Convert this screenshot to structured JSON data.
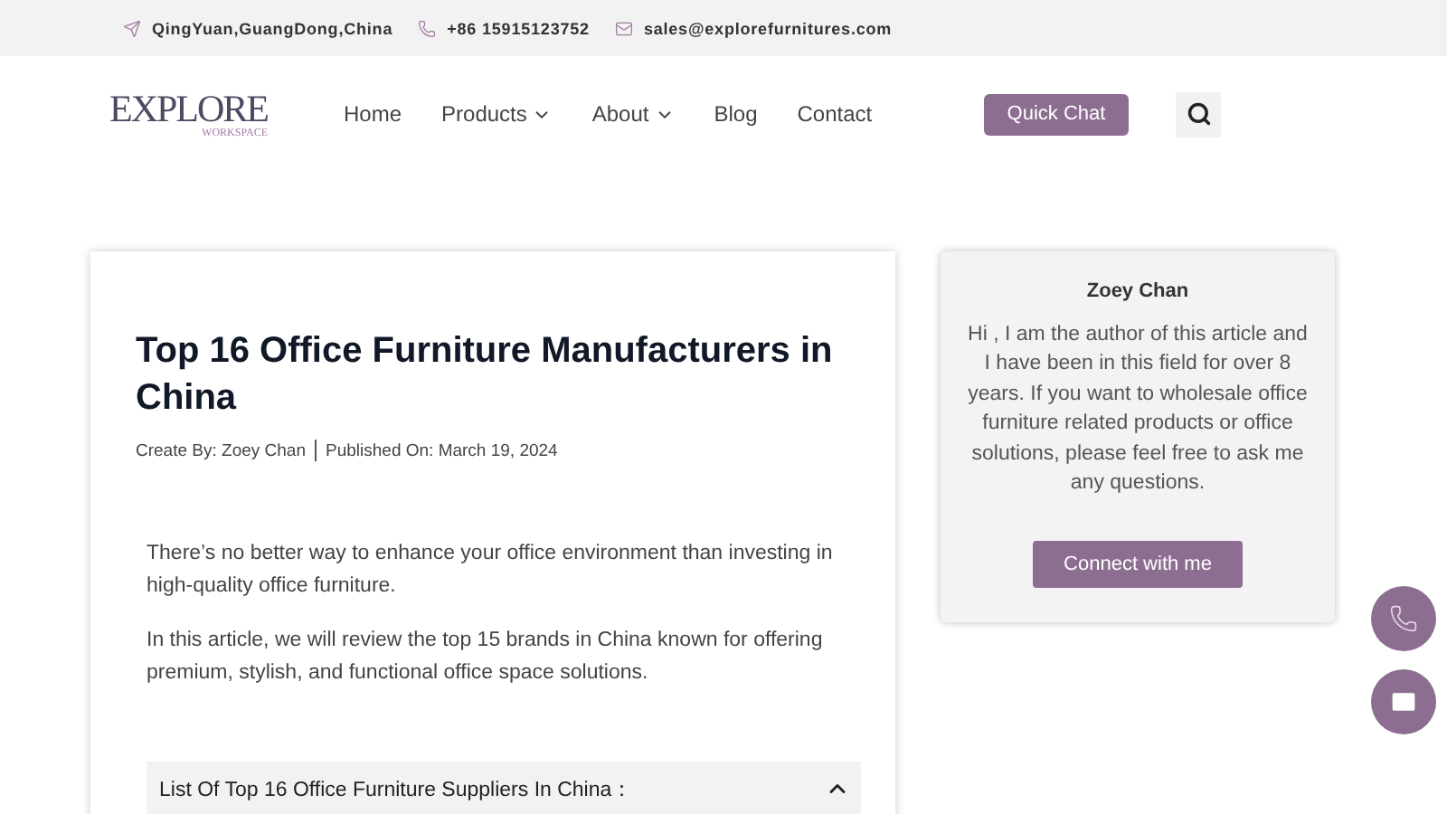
{
  "topbar": [
    {
      "kind": "location",
      "text": "QingYuan,GuangDong,China"
    },
    {
      "kind": "phone",
      "text": "+86 15915123752"
    },
    {
      "kind": "email",
      "text": "sales@explorefurnitures.com"
    }
  ],
  "header": {
    "logo": {
      "main": "EXPLORE",
      "sub": "WORKSPACE"
    },
    "nav": [
      {
        "label": "Home",
        "dropdown": false
      },
      {
        "label": "Products",
        "dropdown": true
      },
      {
        "label": "About",
        "dropdown": true
      },
      {
        "label": "Blog",
        "dropdown": false
      },
      {
        "label": "Contact",
        "dropdown": false
      }
    ],
    "cta": "Quick Chat"
  },
  "article": {
    "title": "Top 16 Office Furniture Manufacturers in China",
    "author": "Create By: Zoey Chan",
    "published": "Published On: March 19, 2024",
    "paragraphs": [
      "There’s no better way to enhance your office environment than investing in high-quality office furniture.",
      "In this article, we will review the top 15 brands in China known for offering premium, stylish, and functional office space solutions."
    ],
    "accordion": {
      "title": "List Of Top 16 Office Furniture Suppliers In China：",
      "expanded": true
    }
  },
  "author_card": {
    "name": "Zoey Chan",
    "bio": "Hi , I am the author of this article and I have been in this field for over 8 years. If you want to wholesale office furniture related products or office solutions, please feel free to ask me any questions.",
    "button": "Connect with me"
  },
  "floating": [
    {
      "kind": "phone"
    },
    {
      "kind": "email"
    }
  ]
}
